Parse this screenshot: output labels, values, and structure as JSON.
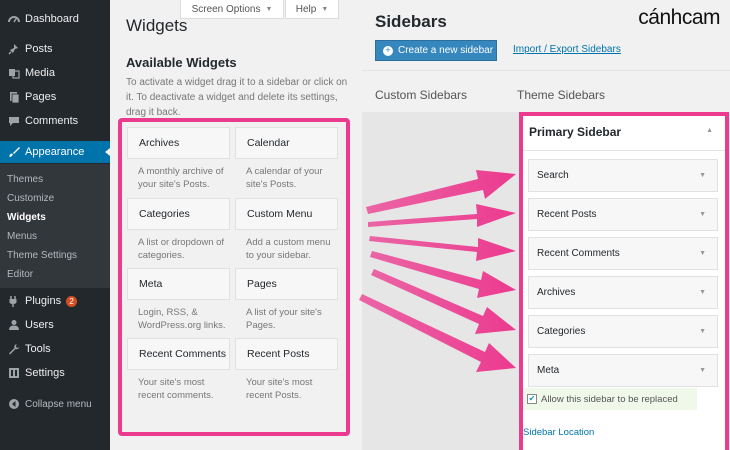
{
  "admin_menu": {
    "items": [
      {
        "label": "Dashboard",
        "icon": "dashboard-icon"
      },
      {
        "label": "Posts",
        "icon": "pin-icon"
      },
      {
        "label": "Media",
        "icon": "media-icon"
      },
      {
        "label": "Pages",
        "icon": "pages-icon"
      },
      {
        "label": "Comments",
        "icon": "comments-icon"
      },
      {
        "label": "Appearance",
        "icon": "brush-icon"
      }
    ],
    "appearance_submenu": [
      "Themes",
      "Customize",
      "Widgets",
      "Menus",
      "Theme Settings",
      "Editor"
    ],
    "items_after": [
      {
        "label": "Plugins",
        "icon": "plug-icon",
        "badge": "2"
      },
      {
        "label": "Users",
        "icon": "users-icon"
      },
      {
        "label": "Tools",
        "icon": "wrench-icon"
      },
      {
        "label": "Settings",
        "icon": "settings-icon"
      }
    ],
    "collapse_label": "Collapse menu"
  },
  "screen_options": {
    "label": "Screen Options",
    "help": "Help"
  },
  "widgets_page": {
    "title": "Widgets",
    "available_title": "Available Widgets",
    "intro": "To activate a widget drag it to a sidebar or click on it. To deactivate a widget and delete its settings, drag it back."
  },
  "available_widgets": [
    {
      "name": "Archives",
      "desc": "A monthly archive of your site's Posts."
    },
    {
      "name": "Calendar",
      "desc": "A calendar of your site's Posts."
    },
    {
      "name": "Categories",
      "desc": "A list or dropdown of categories."
    },
    {
      "name": "Custom Menu",
      "desc": "Add a custom menu to your sidebar."
    },
    {
      "name": "Meta",
      "desc": "Login, RSS, & WordPress.org links."
    },
    {
      "name": "Pages",
      "desc": "A list of your site's Pages."
    },
    {
      "name": "Recent Comments",
      "desc": "Your site's most recent comments."
    },
    {
      "name": "Recent Posts",
      "desc": "Your site's most recent Posts."
    }
  ],
  "sidebars_page": {
    "title": "Sidebars",
    "create_button": "Create a new sidebar",
    "import_link": "Import / Export Sidebars",
    "custom_header": "Custom Sidebars",
    "theme_header": "Theme Sidebars"
  },
  "primary_sidebar": {
    "title": "Primary Sidebar",
    "widgets": [
      "Search",
      "Recent Posts",
      "Recent Comments",
      "Archives",
      "Categories",
      "Meta"
    ],
    "replace_label": "Allow this sidebar to be replaced",
    "replace_checked": true,
    "location_link": "Sidebar Location"
  },
  "brand": "cánhcam",
  "colors": {
    "highlight": "#ec3a8f",
    "admin_bg": "#23282d",
    "accent": "#0073aa",
    "button": "#3587be"
  }
}
